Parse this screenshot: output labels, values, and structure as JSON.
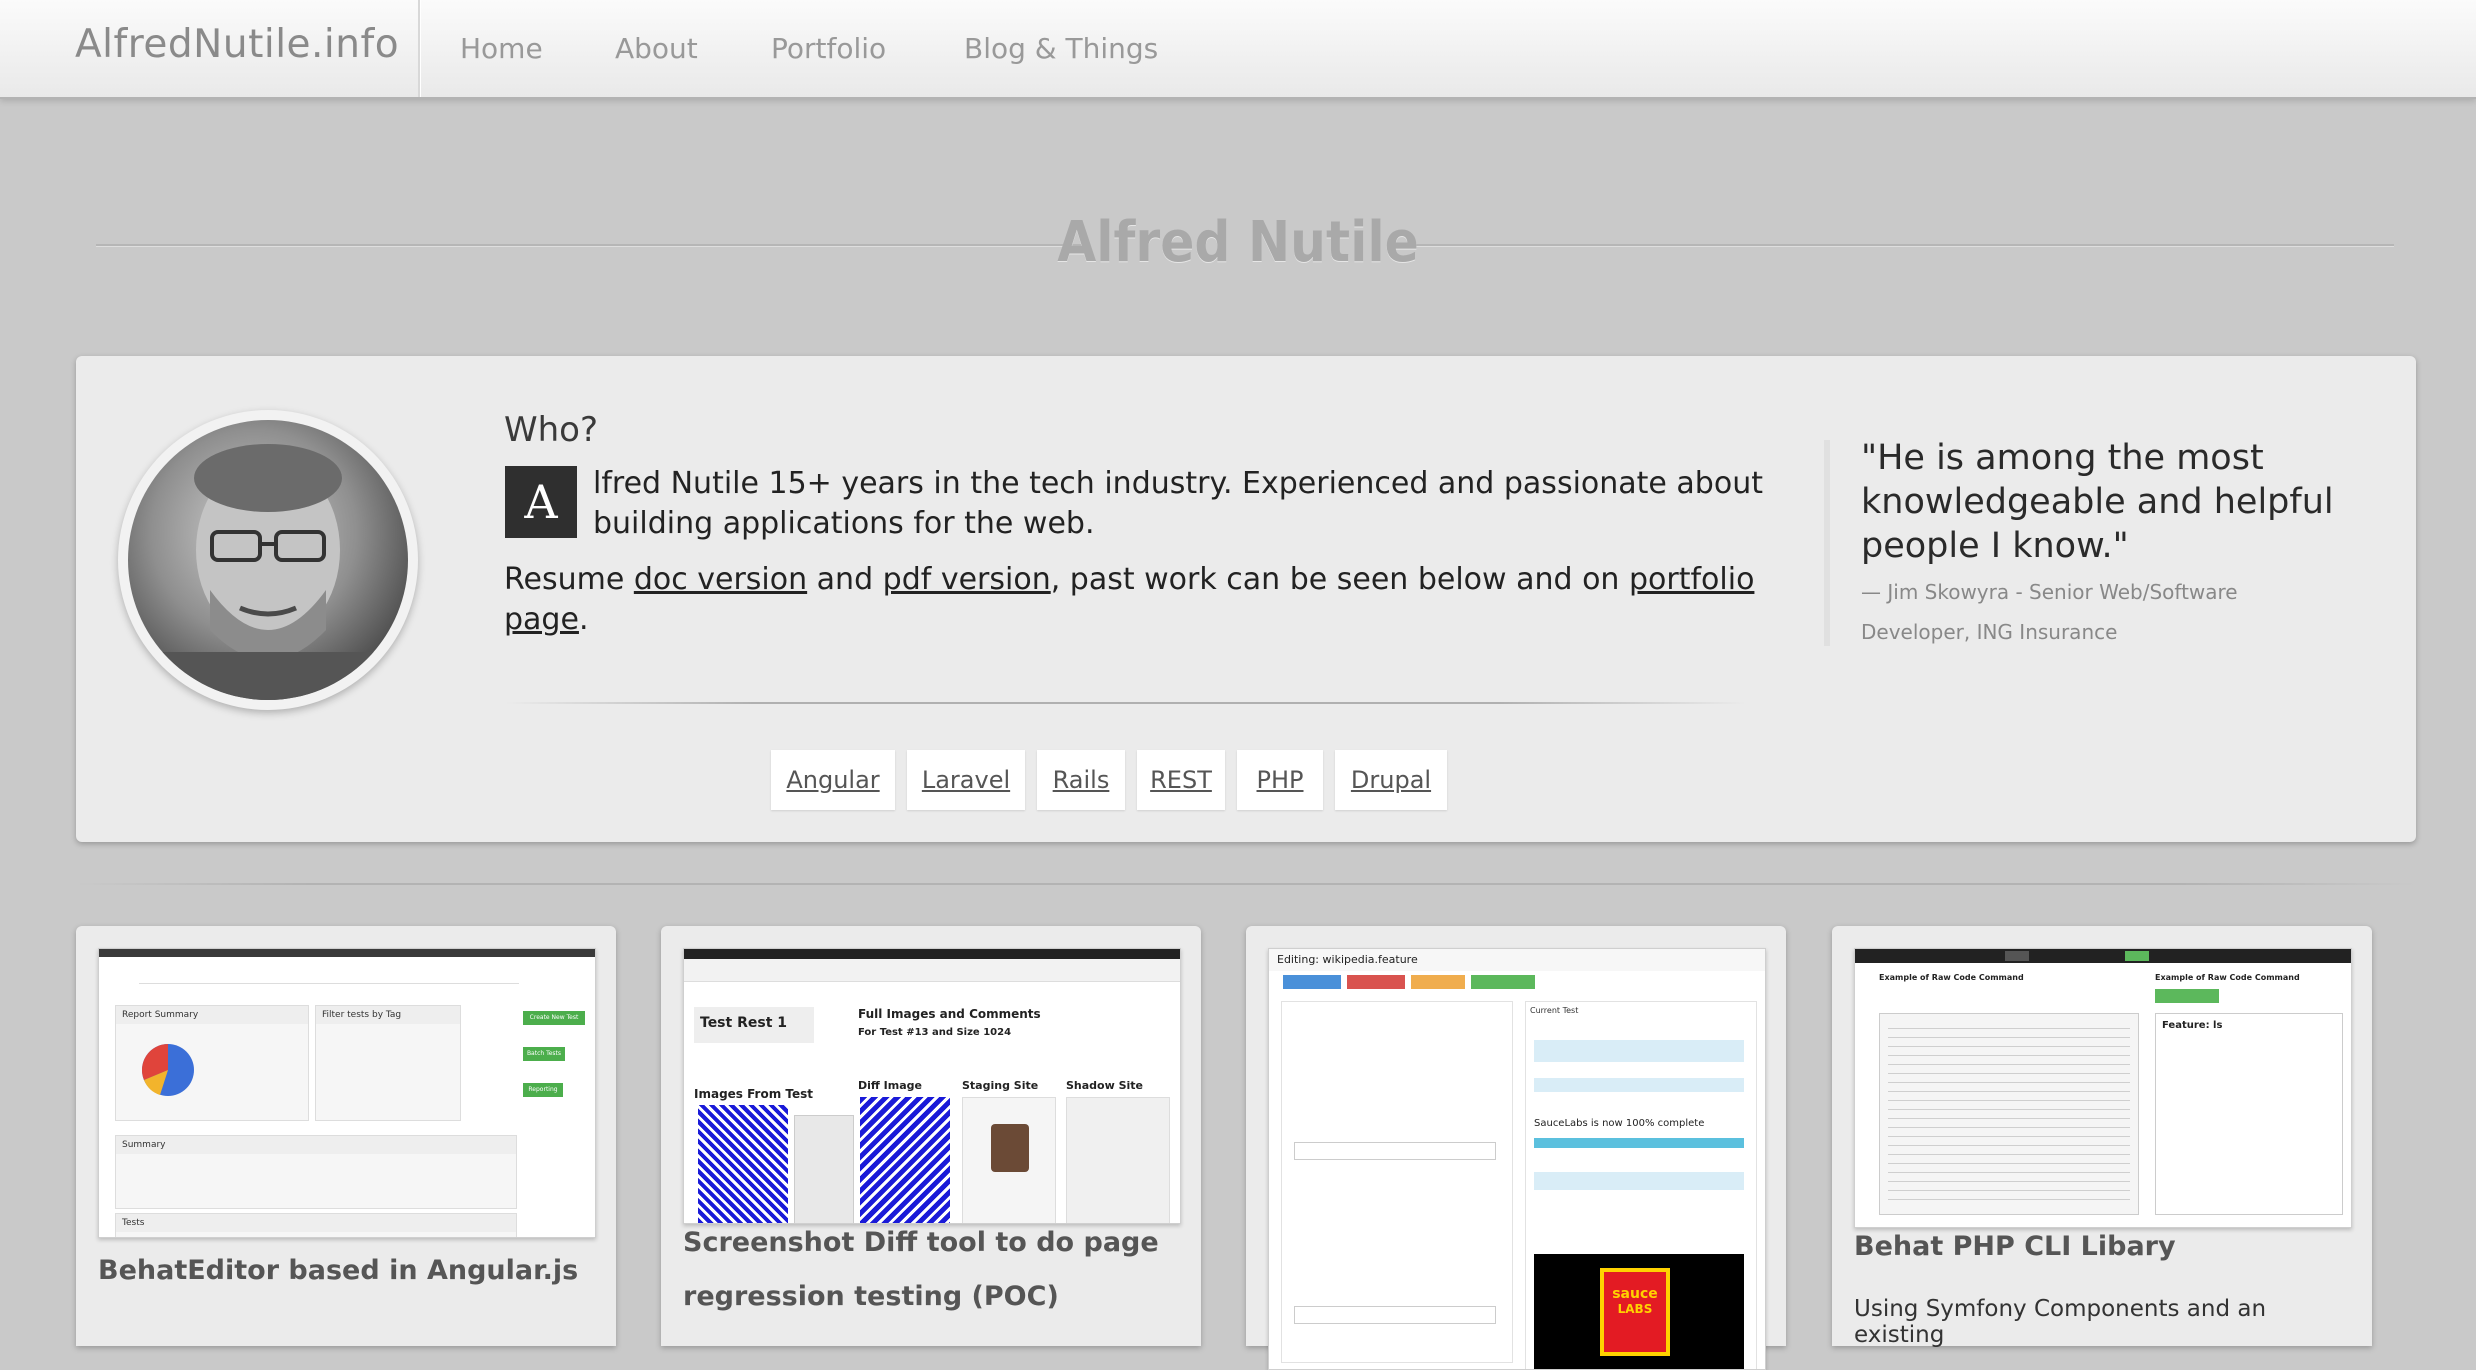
{
  "nav": {
    "brand": "AlfredNutile.info",
    "items": [
      "Home",
      "About",
      "Portfolio",
      "Blog & Things"
    ]
  },
  "hero": {
    "title": "Alfred Nutile"
  },
  "about": {
    "heading": "Who?",
    "dropcap": "A",
    "intro": "lfred Nutile 15+ years in the tech industry. Experienced and passionate about building applications for the web.",
    "resume_prefix": "Resume ",
    "doc_link": "doc version",
    "and": " and ",
    "pdf_link": "pdf version",
    "past_work": ", past work can be seen below and on ",
    "portfolio_link": "portfolio page",
    "period": ".",
    "tags": [
      "Angular",
      "Laravel",
      "Rails",
      "REST",
      "PHP",
      "Drupal"
    ],
    "quote": "\"He is among the most knowledgeable and helpful people I know.\"",
    "quote_author": "— Jim Skowyra - Senior Web/Software Developer, ING Insurance"
  },
  "portfolio": [
    {
      "title": "BehatEditor based in Angular.js",
      "desc": ""
    },
    {
      "title": "Screenshot Diff tool to do page regression testing (POC)",
      "desc": ""
    },
    {
      "title": "",
      "desc": ""
    },
    {
      "title": "Behat PHP CLI Libary",
      "desc": "Using Symfony Components and an existing"
    }
  ],
  "screens": {
    "s1": {
      "report_summary": "Report Summary",
      "filter_tests": "Filter tests by Tag",
      "create_new": "Create New Test",
      "batch_tests": "Batch Tests",
      "reporting": "Reporting",
      "summary": "Summary",
      "tests": "Tests"
    },
    "s2": {
      "heading": "Full Images and Comments",
      "sub": "For Test #13 and Size 1024",
      "test_rest": "Test Rest 1",
      "images_from_test": "Images From Test",
      "diff_image": "Diff Image",
      "staging_site": "Staging Site",
      "shadow_site": "Shadow Site"
    },
    "s3": {
      "title": "Editing: wikipedia.feature",
      "current_test": "Current Test",
      "complete": "SauceLabs is now 100% complete",
      "sauce": "sauce",
      "labs": "LABS"
    },
    "s4": {
      "example": "Example of Raw Code Command",
      "feature": "Feature: ls"
    }
  },
  "colors": {
    "background": "#c9c9c9",
    "card": "#ebebeb",
    "dropcap_bg": "#2f2f2f",
    "link": "#222222"
  }
}
